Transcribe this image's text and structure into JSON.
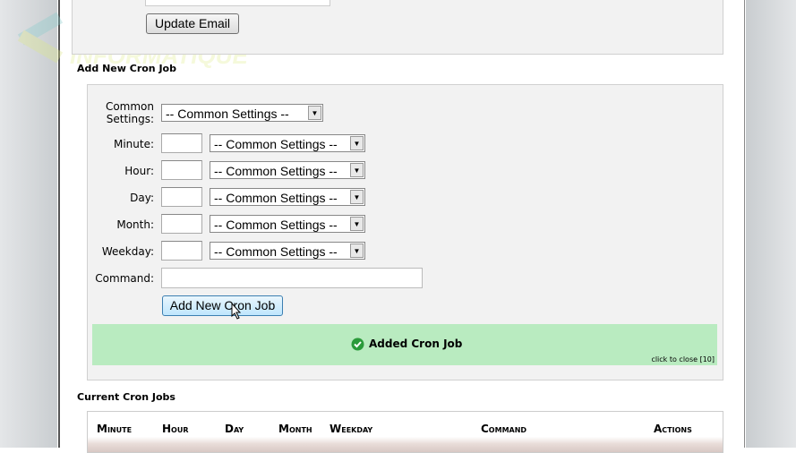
{
  "watermark": {
    "line1": "NTSI",
    "line2": "INFORMATIQUE"
  },
  "email_section": {
    "update_button": "Update Email"
  },
  "add_cron": {
    "heading": "Add New Cron Job",
    "common_label": "Common Settings:",
    "common_value": "-- Common Settings --",
    "fields": [
      {
        "label": "Minute:",
        "value": "",
        "select": "-- Common Settings --"
      },
      {
        "label": "Hour:",
        "value": "",
        "select": "-- Common Settings --"
      },
      {
        "label": "Day:",
        "value": "",
        "select": "-- Common Settings --"
      },
      {
        "label": "Month:",
        "value": "",
        "select": "-- Common Settings --"
      },
      {
        "label": "Weekday:",
        "value": "",
        "select": "-- Common Settings --"
      }
    ],
    "command_label": "Command:",
    "command_value": "",
    "submit_button": "Add New Cron Job"
  },
  "notice": {
    "message": "Added Cron Job",
    "close": "click to close [10]",
    "color": "#b9ebc0",
    "icon": "check-circle-icon"
  },
  "current": {
    "heading": "Current Cron Jobs",
    "columns": [
      "Minute",
      "Hour",
      "Day",
      "Month",
      "Weekday",
      "Command",
      "Actions"
    ]
  }
}
